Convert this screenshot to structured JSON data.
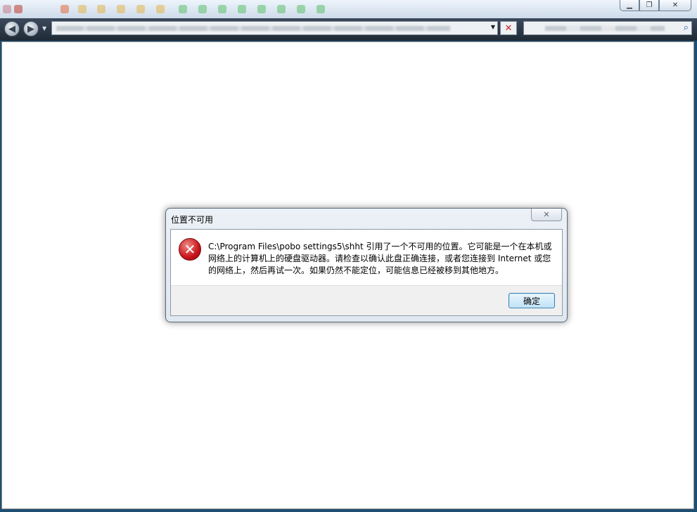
{
  "browser": {
    "window_controls": {
      "minimize_icon": "minimize-icon",
      "maximize_icon": "restore-icon",
      "close_icon": "close-icon"
    },
    "toolbar_icon_colors": [
      "#c77b8a",
      "#c0392b",
      "#e26a3a",
      "#e6b34a",
      "#e3b54a",
      "#e3b54a",
      "#e3b54a",
      "#e3b54a",
      "#5cbf6a",
      "#5cbf6a",
      "#5cbf6a",
      "#5cbf6a",
      "#5cbf6a",
      "#5cbf6a",
      "#5cbf6a",
      "#5cbf6a"
    ],
    "address": {
      "value": ""
    },
    "search": {
      "value": ""
    }
  },
  "dialog": {
    "title": "位置不可用",
    "close_glyph": "✕",
    "error_glyph": "✕",
    "message": "C:\\Program Files\\pobo settings5\\shht 引用了一个不可用的位置。它可能是一个在本机或网络上的计算机上的硬盘驱动器。请检查以确认此盘正确连接，或者您连接到 Internet 或您的网络上，然后再试一次。如果仍然不能定位，可能信息已经被移到其他地方。",
    "ok_label": "确定"
  },
  "colors": {
    "error_red": "#c8141c",
    "button_border": "#3c7fb1",
    "frame_dark": "#1f2a36"
  }
}
